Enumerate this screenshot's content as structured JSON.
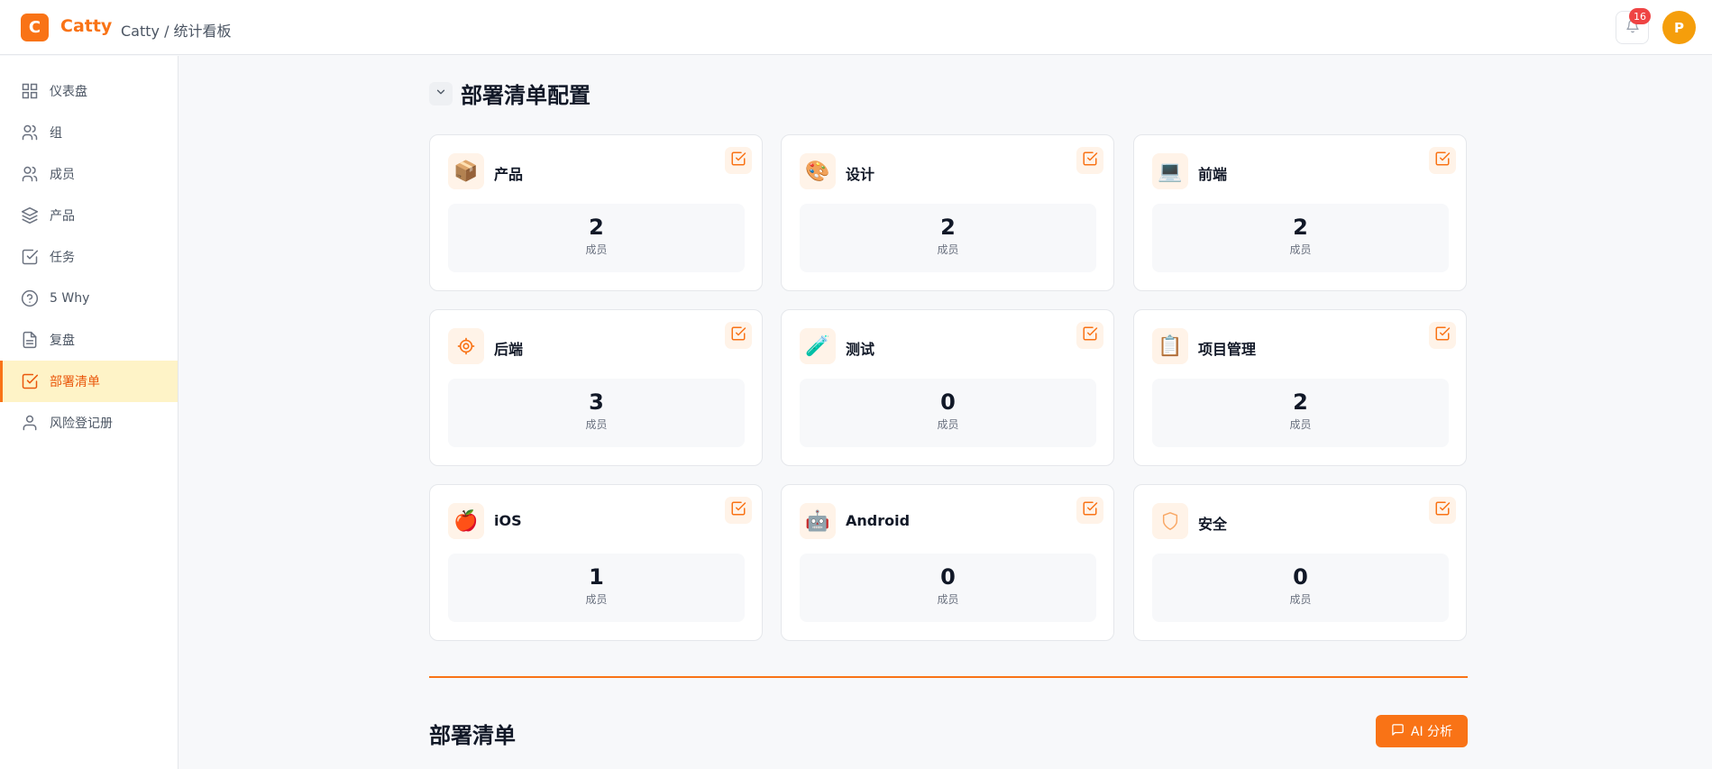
{
  "header": {
    "logo_letter": "C",
    "app_name": "Catty",
    "breadcrumb": "Catty / 统计看板",
    "notification_count": "16",
    "avatar_letter": "P"
  },
  "sidebar": {
    "items": [
      {
        "label": "仪表盘",
        "icon": "dashboard-grid-icon"
      },
      {
        "label": "组",
        "icon": "users-icon"
      },
      {
        "label": "成员",
        "icon": "users-icon"
      },
      {
        "label": "产品",
        "icon": "layers-icon"
      },
      {
        "label": "任务",
        "icon": "check-square-icon"
      },
      {
        "label": "5 Why",
        "icon": "help-circle-icon"
      },
      {
        "label": "复盘",
        "icon": "document-icon"
      },
      {
        "label": "部署清单",
        "icon": "check-square-icon",
        "active": true
      },
      {
        "label": "风险登记册",
        "icon": "user-icon"
      }
    ]
  },
  "section": {
    "title": "部署清单配置"
  },
  "cards": [
    {
      "title": "产品",
      "emoji": "📦",
      "count": "2",
      "label": "成员"
    },
    {
      "title": "设计",
      "emoji": "🎨",
      "count": "2",
      "label": "成员"
    },
    {
      "title": "前端",
      "emoji": "💻",
      "count": "2",
      "label": "成员"
    },
    {
      "title": "后端",
      "emoji": "⚙",
      "count": "3",
      "label": "成员"
    },
    {
      "title": "测试",
      "emoji": "🧪",
      "count": "0",
      "label": "成员"
    },
    {
      "title": "项目管理",
      "emoji": "📋",
      "count": "2",
      "label": "成员"
    },
    {
      "title": "iOS",
      "emoji": "🍎",
      "count": "1",
      "label": "成员"
    },
    {
      "title": "Android",
      "emoji": "🤖",
      "count": "0",
      "label": "成员"
    },
    {
      "title": "安全",
      "emoji": "🛡",
      "count": "0",
      "label": "成员"
    }
  ],
  "bottom": {
    "title": "部署清单",
    "ai_button": "AI 分析"
  },
  "colors": {
    "accent": "#f97316",
    "active_bg": "#fef3c7",
    "badge": "#ef4444"
  }
}
